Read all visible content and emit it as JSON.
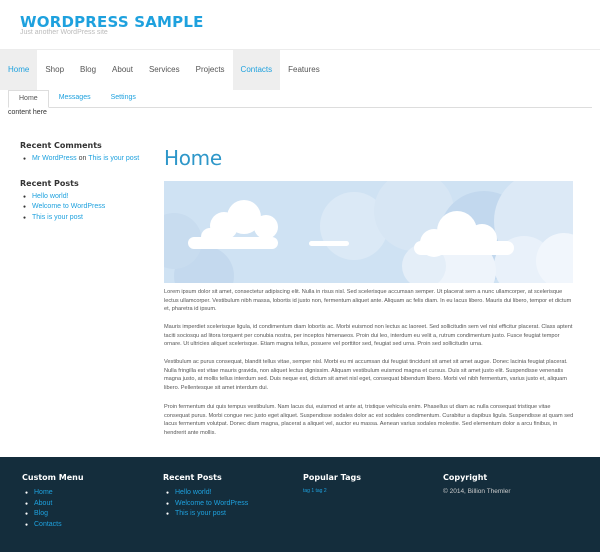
{
  "site": {
    "title": "WORDPRESS SAMPLE",
    "tagline": "Just another WordPress site"
  },
  "main_nav": [
    {
      "label": "Home",
      "active": true
    },
    {
      "label": "Shop",
      "active": false
    },
    {
      "label": "Blog",
      "active": false
    },
    {
      "label": "About",
      "active": false
    },
    {
      "label": "Services",
      "active": false
    },
    {
      "label": "Projects",
      "active": false
    },
    {
      "label": "Contacts",
      "active": true
    },
    {
      "label": "Features",
      "active": false
    }
  ],
  "sub_nav": [
    {
      "label": "Home",
      "active": true
    },
    {
      "label": "Messages",
      "active": false
    },
    {
      "label": "Settings",
      "active": false
    }
  ],
  "content_note": "content here",
  "sidebar": {
    "recent_comments": {
      "title": "Recent Comments",
      "author": "Mr WordPress",
      "on": "on",
      "post": "This is your post"
    },
    "recent_posts": {
      "title": "Recent Posts",
      "items": [
        "Hello world!",
        "Welcome to WordPress",
        "This is your post"
      ]
    }
  },
  "main": {
    "heading": "Home",
    "paragraphs": [
      "Lorem ipsum dolor sit amet, consectetur adipiscing elit. Nulla in risus nisl. Sed scelerisque accumsan semper. Ut placerat sem a nunc ullamcorper, at scelerisque lectus ullamcorper. Vestibulum nibh massa, lobortis id justo non, fermentum aliquet ante. Aliquam ac felis diam. In eu lacus libero. Mauris dui libero, tempor et dictum et, pharetra id ipsum.",
      "Mauris imperdiet scelerisque ligula, id condimentum diam lobortis ac. Morbi euismod non lectus ac laoreet. Sed sollicitudin sem vel nisl efficitur placerat. Class aptent taciti sociosqu ad litora torquent per conubia nostra, per inceptos himenaeos. Proin dui leo, interdum eu velit a, rutrum condimentum justo. Fusce feugiat tempor ornare. Ut ultricies aliquet scelerisque. Etiam magna tellus, posuere vel porttitor sed, feugiat sed urna. Proin sed sollicitudin urna.",
      "Vestibulum ac purus consequat, blandit tellus vitae, semper nisl. Morbi eu mi accumsan dui feugiat tincidunt sit amet sit amet augue. Donec lacinia feugiat placerat. Nulla fringilla est vitae mauris gravida, non aliquet lectus dignissim. Aliquam vestibulum euismod magna et cursus. Duis sit amet justo elit. Suspendisse venenatis magna justo, at mollis tellus interdum sed. Duis neque est, dictum sit amet nisl eget, consequat bibendum libero. Morbi vel nibh fermentum, varius justo et, aliquam libero. Pellentesque sit amet interdum dui.",
      "Proin fermentum dui quis tempus vestibulum. Nam lacus dui, euismod et ante at, tristique vehicula enim. Phasellus ut diam ac nulla consequat tristique vitae consequat purus. Morbi congue nec justo eget aliquet. Suspendisse sodales dolor ac est sodales condimentum. Curabitur a dapibus ligula. Suspendisse at quam sed lacus fermentum volutpat. Donec diam magna, placerat a aliquet vel, auctor eu massa. Aenean varius sodales molestie. Sed elementum dolor a arcu finibus, in hendrerit ante mollis."
    ]
  },
  "footer": {
    "custom_menu": {
      "title": "Custom Menu",
      "items": [
        "Home",
        "About",
        "Blog",
        "Contacts"
      ]
    },
    "recent_posts": {
      "title": "Recent Posts",
      "items": [
        "Hello world!",
        "Welcome to WordPress",
        "This is your post"
      ]
    },
    "popular_tags": {
      "title": "Popular Tags",
      "tags": [
        "tag 1",
        "tag 2"
      ]
    },
    "copyright": {
      "title": "Copyright",
      "text": "© 2014, Billion Themler"
    }
  },
  "colors": {
    "accent": "#1ea1de",
    "heading": "#2e97c9",
    "footer_bg": "#142d3c",
    "hero_sky": "#cfe2f3"
  }
}
